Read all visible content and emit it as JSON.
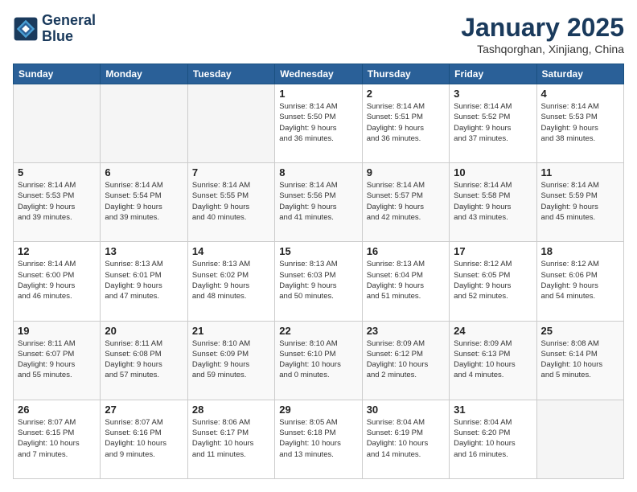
{
  "logo": {
    "line1": "General",
    "line2": "Blue"
  },
  "header": {
    "month": "January 2025",
    "location": "Tashqorghan, Xinjiang, China"
  },
  "weekdays": [
    "Sunday",
    "Monday",
    "Tuesday",
    "Wednesday",
    "Thursday",
    "Friday",
    "Saturday"
  ],
  "weeks": [
    [
      {
        "day": "",
        "info": ""
      },
      {
        "day": "",
        "info": ""
      },
      {
        "day": "",
        "info": ""
      },
      {
        "day": "1",
        "info": "Sunrise: 8:14 AM\nSunset: 5:50 PM\nDaylight: 9 hours\nand 36 minutes."
      },
      {
        "day": "2",
        "info": "Sunrise: 8:14 AM\nSunset: 5:51 PM\nDaylight: 9 hours\nand 36 minutes."
      },
      {
        "day": "3",
        "info": "Sunrise: 8:14 AM\nSunset: 5:52 PM\nDaylight: 9 hours\nand 37 minutes."
      },
      {
        "day": "4",
        "info": "Sunrise: 8:14 AM\nSunset: 5:53 PM\nDaylight: 9 hours\nand 38 minutes."
      }
    ],
    [
      {
        "day": "5",
        "info": "Sunrise: 8:14 AM\nSunset: 5:53 PM\nDaylight: 9 hours\nand 39 minutes."
      },
      {
        "day": "6",
        "info": "Sunrise: 8:14 AM\nSunset: 5:54 PM\nDaylight: 9 hours\nand 39 minutes."
      },
      {
        "day": "7",
        "info": "Sunrise: 8:14 AM\nSunset: 5:55 PM\nDaylight: 9 hours\nand 40 minutes."
      },
      {
        "day": "8",
        "info": "Sunrise: 8:14 AM\nSunset: 5:56 PM\nDaylight: 9 hours\nand 41 minutes."
      },
      {
        "day": "9",
        "info": "Sunrise: 8:14 AM\nSunset: 5:57 PM\nDaylight: 9 hours\nand 42 minutes."
      },
      {
        "day": "10",
        "info": "Sunrise: 8:14 AM\nSunset: 5:58 PM\nDaylight: 9 hours\nand 43 minutes."
      },
      {
        "day": "11",
        "info": "Sunrise: 8:14 AM\nSunset: 5:59 PM\nDaylight: 9 hours\nand 45 minutes."
      }
    ],
    [
      {
        "day": "12",
        "info": "Sunrise: 8:14 AM\nSunset: 6:00 PM\nDaylight: 9 hours\nand 46 minutes."
      },
      {
        "day": "13",
        "info": "Sunrise: 8:13 AM\nSunset: 6:01 PM\nDaylight: 9 hours\nand 47 minutes."
      },
      {
        "day": "14",
        "info": "Sunrise: 8:13 AM\nSunset: 6:02 PM\nDaylight: 9 hours\nand 48 minutes."
      },
      {
        "day": "15",
        "info": "Sunrise: 8:13 AM\nSunset: 6:03 PM\nDaylight: 9 hours\nand 50 minutes."
      },
      {
        "day": "16",
        "info": "Sunrise: 8:13 AM\nSunset: 6:04 PM\nDaylight: 9 hours\nand 51 minutes."
      },
      {
        "day": "17",
        "info": "Sunrise: 8:12 AM\nSunset: 6:05 PM\nDaylight: 9 hours\nand 52 minutes."
      },
      {
        "day": "18",
        "info": "Sunrise: 8:12 AM\nSunset: 6:06 PM\nDaylight: 9 hours\nand 54 minutes."
      }
    ],
    [
      {
        "day": "19",
        "info": "Sunrise: 8:11 AM\nSunset: 6:07 PM\nDaylight: 9 hours\nand 55 minutes."
      },
      {
        "day": "20",
        "info": "Sunrise: 8:11 AM\nSunset: 6:08 PM\nDaylight: 9 hours\nand 57 minutes."
      },
      {
        "day": "21",
        "info": "Sunrise: 8:10 AM\nSunset: 6:09 PM\nDaylight: 9 hours\nand 59 minutes."
      },
      {
        "day": "22",
        "info": "Sunrise: 8:10 AM\nSunset: 6:10 PM\nDaylight: 10 hours\nand 0 minutes."
      },
      {
        "day": "23",
        "info": "Sunrise: 8:09 AM\nSunset: 6:12 PM\nDaylight: 10 hours\nand 2 minutes."
      },
      {
        "day": "24",
        "info": "Sunrise: 8:09 AM\nSunset: 6:13 PM\nDaylight: 10 hours\nand 4 minutes."
      },
      {
        "day": "25",
        "info": "Sunrise: 8:08 AM\nSunset: 6:14 PM\nDaylight: 10 hours\nand 5 minutes."
      }
    ],
    [
      {
        "day": "26",
        "info": "Sunrise: 8:07 AM\nSunset: 6:15 PM\nDaylight: 10 hours\nand 7 minutes."
      },
      {
        "day": "27",
        "info": "Sunrise: 8:07 AM\nSunset: 6:16 PM\nDaylight: 10 hours\nand 9 minutes."
      },
      {
        "day": "28",
        "info": "Sunrise: 8:06 AM\nSunset: 6:17 PM\nDaylight: 10 hours\nand 11 minutes."
      },
      {
        "day": "29",
        "info": "Sunrise: 8:05 AM\nSunset: 6:18 PM\nDaylight: 10 hours\nand 13 minutes."
      },
      {
        "day": "30",
        "info": "Sunrise: 8:04 AM\nSunset: 6:19 PM\nDaylight: 10 hours\nand 14 minutes."
      },
      {
        "day": "31",
        "info": "Sunrise: 8:04 AM\nSunset: 6:20 PM\nDaylight: 10 hours\nand 16 minutes."
      },
      {
        "day": "",
        "info": ""
      }
    ]
  ]
}
